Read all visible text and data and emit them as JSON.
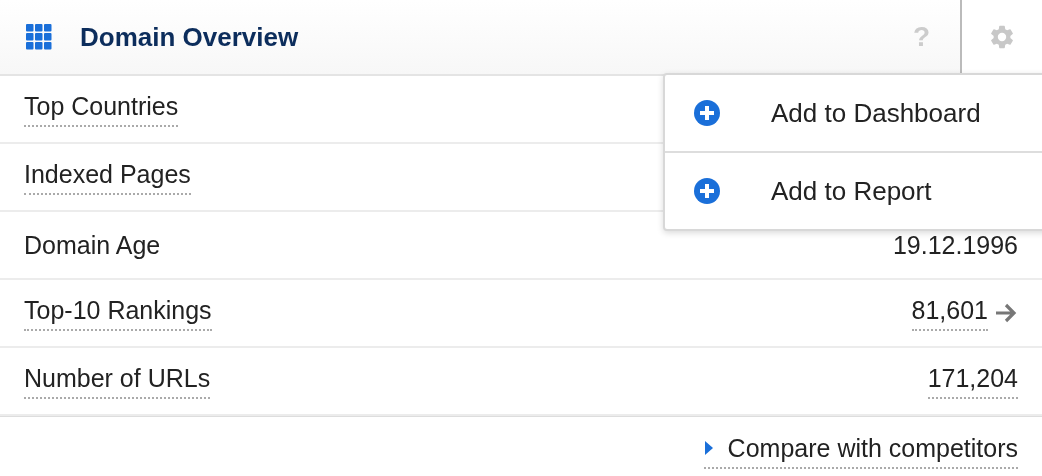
{
  "header": {
    "title": "Domain Overview",
    "help": "?"
  },
  "rows": [
    {
      "label": "Top Countries",
      "underlined": true
    },
    {
      "label": "Indexed Pages",
      "underlined": true
    },
    {
      "label": "Domain Age",
      "underlined": false,
      "value": "19.12.1996",
      "value_underlined": false,
      "arrow": false
    },
    {
      "label": "Top-10 Rankings",
      "underlined": true,
      "value": "81,601",
      "value_underlined": true,
      "arrow": true
    },
    {
      "label": "Number of URLs",
      "underlined": true,
      "value": "171,204",
      "value_underlined": true,
      "arrow": false
    }
  ],
  "footer": {
    "link": "Compare with competitors"
  },
  "menu": {
    "items": [
      {
        "label": "Add to Dashboard"
      },
      {
        "label": "Add to Report"
      }
    ]
  }
}
